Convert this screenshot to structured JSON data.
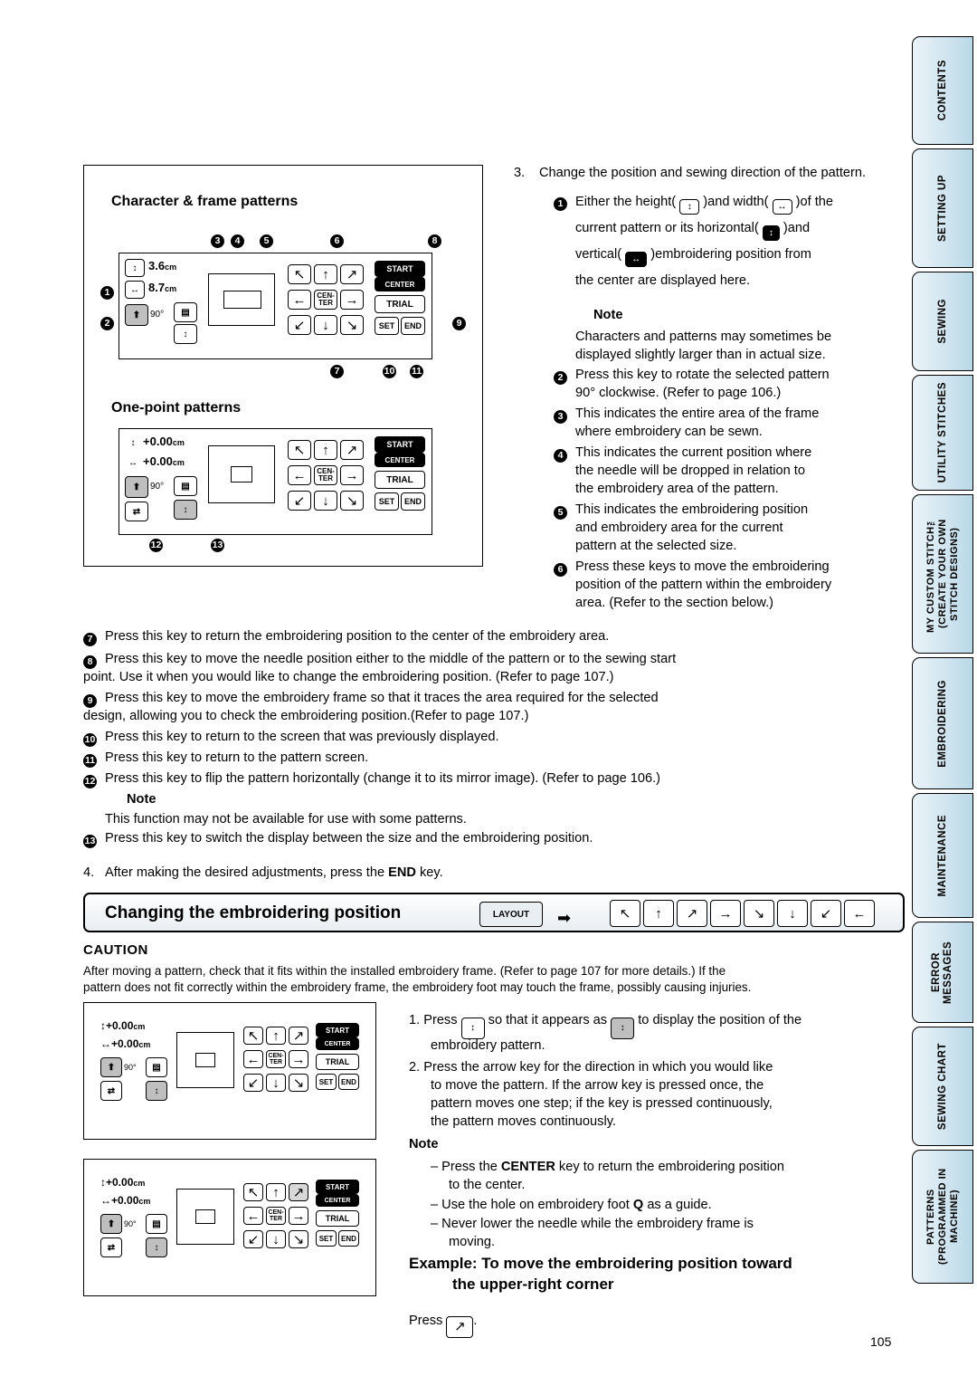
{
  "page": {
    "number": "105"
  },
  "side_tabs": [
    {
      "label": "CONTENTS"
    },
    {
      "label": "SETTING UP"
    },
    {
      "label": "SEWING"
    },
    {
      "label": "UTILITY STITCHES"
    },
    {
      "label": "MY CUSTOM STITCH™ (CREATE YOUR OWN STITCH DESIGNS)"
    },
    {
      "label": "EMBROIDERING"
    },
    {
      "label": "MAINTENANCE"
    },
    {
      "label": "ERROR MESSAGES"
    },
    {
      "label": "SEWING CHART"
    },
    {
      "label": "PATTERNS (PROGRAMMED IN MACHINE)"
    }
  ],
  "panel_top": {
    "title_char": "Character & frame patterns",
    "title_one": "One-point patterns",
    "height_value": "3.6",
    "width_value": "8.7",
    "unit": "cm",
    "one_point_height": "+0.00",
    "one_point_width": "+0.00",
    "deg": "90",
    "keys": {
      "start": "START",
      "center_top": "CENTER",
      "cen": "CEN-",
      "ter": "TER",
      "trial": "TRIAL",
      "set": "SET",
      "end": "END"
    },
    "callouts": [
      "1",
      "2",
      "3",
      "4",
      "5",
      "6",
      "7",
      "8",
      "9",
      "10",
      "11",
      "12",
      "13"
    ]
  },
  "right_col": {
    "step3": "Change the position and sewing direction of the pattern.",
    "item1_a": "Either the height(",
    "item1_b": ")and width(",
    "item1_c": ")of the",
    "item1_l2_a": "current pattern or its horizontal(",
    "item1_l2_b": ")and",
    "item1_l3_a": "vertical(",
    "item1_l3_b": ")embroidering position from",
    "item1_l4": "the center are displayed here.",
    "note_label": "Note",
    "note_l1": "Characters and patterns may sometimes be",
    "note_l2": "displayed slightly larger than in actual size.",
    "item2_l1": "Press this key to rotate the selected pattern",
    "item2_l2": "90° clockwise. (Refer to page 106.)",
    "item3_l1": "This indicates the entire area of the frame",
    "item3_l2": "where embroidery can be sewn.",
    "item4_l1": "This indicates the current position where",
    "item4_l2": "the needle will be dropped in relation to",
    "item4_l3": "the embroidery area of the pattern.",
    "item5_l1": "This indicates the embroidering position",
    "item5_l2": "and embroidery area for the current",
    "item5_l3": "pattern at the selected size.",
    "item6_l1": "Press these keys to move the embroidering",
    "item6_l2": "position of the pattern within the embroidery",
    "item6_l3": "area. (Refer to the section below.)"
  },
  "list_below": {
    "i7": "Press this key to return the embroidering position to the center of the embroidery area.",
    "i8_l1": "Press this key to move the needle position either to the middle of the pattern or to the sewing start",
    "i8_l2": "point. Use it when you would like to change the embroidering position. (Refer to page 107.)",
    "i9_l1": "Press this key to move the embroidery frame so that it traces the area required for the selected",
    "i9_l2": "design, allowing you to check the embroidering position.(Refer to page 107.)",
    "i10": "Press this key to return to the screen that was previously displayed.",
    "i11": "Press this key to return to the pattern screen.",
    "i12": "Press this key to flip the pattern horizontally (change it to its mirror image). (Refer to page 106.)",
    "note_label": "Note",
    "note_text": "This function may not be available for use with some patterns.",
    "i13": "Press this key to switch the display between the size and the embroidering position.",
    "step4_a": "After making the desired adjustments, press the ",
    "step4_b": "END",
    "step4_c": " key."
  },
  "section": {
    "title": "Changing the embroidering position",
    "layout_key": "LAYOUT",
    "caution_label": "CAUTION",
    "caution_l1": "After moving a pattern, check that it fits within the installed embroidery frame. (Refer to page 107 for more details.) If the",
    "caution_l2": "pattern does not fit correctly within the embroidery frame, the embroidery foot may touch the frame, possibly causing injuries."
  },
  "bottom_right": {
    "s1_a": "1. Press",
    "s1_b": "so that it appears as",
    "s1_c": "to display the position of the",
    "s1_d": "embroidery pattern.",
    "s2_l1": "2. Press the arrow key for the direction in which you would like",
    "s2_l2": "to move the pattern. If the arrow key is pressed once, the",
    "s2_l3": "pattern moves one step; if the key is pressed continuously,",
    "s2_l4": "the pattern moves continuously.",
    "note_label": "Note",
    "n1_a": "– Press the ",
    "n1_b": "CENTER",
    "n1_c": " key to return the embroidering position",
    "n1_d": "to the center.",
    "n2_a": "– Use the hole on embroidery foot ",
    "n2_b": "Q",
    "n2_c": " as a guide.",
    "n3_l1": "– Never lower the needle while the embroidery frame is",
    "n3_l2": "moving.",
    "example_l1": "Example: To move the embroidering position toward",
    "example_l2": "the upper-right corner",
    "press": "Press"
  },
  "panel_keys": {
    "height_zero": "+0.00",
    "width_zero": "+0.00",
    "unit": "cm",
    "deg": "90"
  }
}
